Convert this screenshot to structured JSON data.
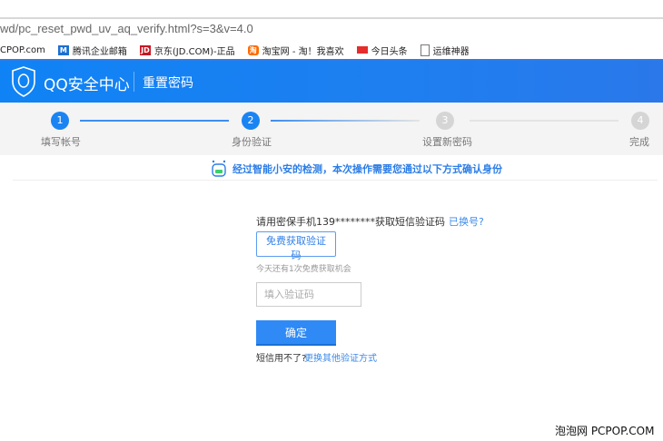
{
  "browser": {
    "url": "wd/pc_reset_pwd_uv_aq_verify.html?s=3&v=4.0",
    "bookmarks": [
      {
        "label": "CPOP.com",
        "icon": "none"
      },
      {
        "label": "腾讯企业邮箱",
        "icon": "mail-icon",
        "color": "#1d6fd1"
      },
      {
        "label": "京东(JD.COM)-正品",
        "icon": "jd-icon",
        "color": "#c81623"
      },
      {
        "label": "淘宝网 - 淘！我喜欢",
        "icon": "taobao-icon",
        "color": "#ff6a00"
      },
      {
        "label": "今日头条",
        "icon": "toutiao-icon",
        "color": "#e62c2c"
      },
      {
        "label": "运维神器",
        "icon": "page-icon"
      }
    ]
  },
  "header": {
    "title": "QQ安全中心",
    "subtitle": "重置密码"
  },
  "steps": [
    {
      "num": "1",
      "label": "填写帐号",
      "active": true
    },
    {
      "num": "2",
      "label": "身份验证",
      "active": true
    },
    {
      "num": "3",
      "label": "设置新密码",
      "active": false
    },
    {
      "num": "4",
      "label": "完成",
      "active": false
    }
  ],
  "notice": "经过智能小安的检测，本次操作需要您通过以下方式确认身份",
  "form": {
    "phone_text": "请用密保手机139********获取短信验证码",
    "changed_link": "已换号?",
    "get_code": "免费获取验证码",
    "remaining": "今天还有1次免费获取机会",
    "code_placeholder": "填入验证码",
    "confirm": "确定",
    "no_sms": "短信用不了?",
    "other_method": "更换其他验证方式"
  },
  "watermark": "泡泡网 PCPOP.COM",
  "colors": {
    "primary": "#1a84f3",
    "inactive": "#d5d5d5"
  }
}
